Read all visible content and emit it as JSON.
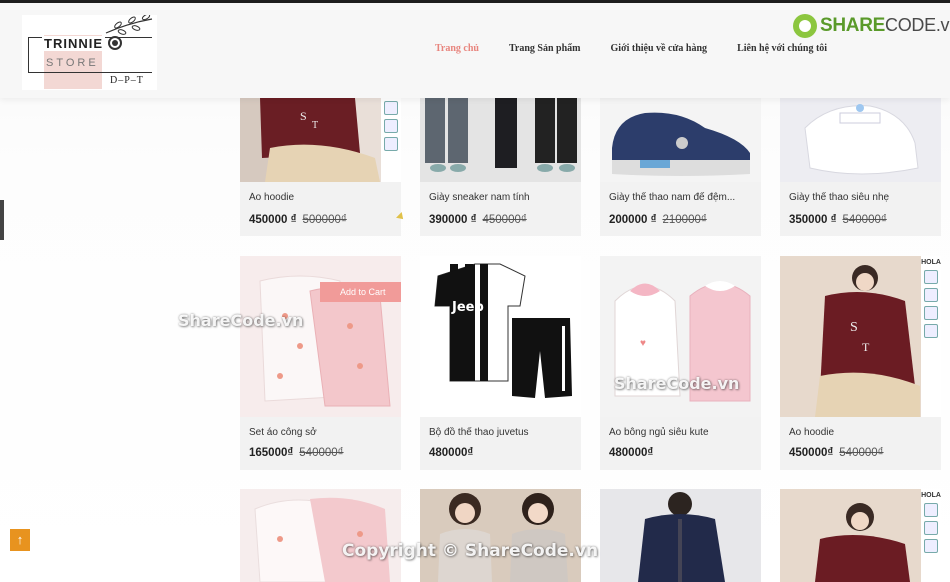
{
  "logo": {
    "line1": "TRINNIE",
    "line2": "STORE",
    "line3": "D–P–T"
  },
  "nav": [
    {
      "label": "Trang chủ",
      "active": true
    },
    {
      "label": "Trang Sản phẩm"
    },
    {
      "label": "Giới thiệu về cửa hàng"
    },
    {
      "label": "Liên hệ với chúng tôi"
    }
  ],
  "brand": {
    "name_part1": "SHARE",
    "name_part2": "CODE.vn"
  },
  "products": [
    {
      "name": "Áo hoodie",
      "price": "450000 ₫",
      "old_price": "500000₫"
    },
    {
      "name": "Giày sneaker nam tính",
      "price": "390000 ₫",
      "old_price": "450000₫"
    },
    {
      "name": "Giày thể thao nam để đệm...",
      "price": "200000 ₫",
      "old_price": "210000₫"
    },
    {
      "name": "Giày thể thao siêu nhẹ",
      "price": "350000 ₫",
      "old_price": "540000₫"
    },
    {
      "name": "Set áo công sở",
      "price": "165000₫",
      "old_price": "540000₫",
      "add_to_cart": "Add to Cart"
    },
    {
      "name": "Bộ đồ thể thao juvetus",
      "price": "480000₫",
      "old_price": ""
    },
    {
      "name": "Áo bông ngủ siêu kute",
      "price": "480000₫",
      "old_price": ""
    },
    {
      "name": "Áo hoodie",
      "price": "450000₫",
      "old_price": "540000₫"
    }
  ],
  "badges": {
    "hola": "HOLA"
  },
  "watermarks": {
    "w1": "ShareCode.vn",
    "w2": "ShareCode.vn",
    "copyright": "Copyright © ShareCode.vn"
  },
  "back_to_top": "↑"
}
